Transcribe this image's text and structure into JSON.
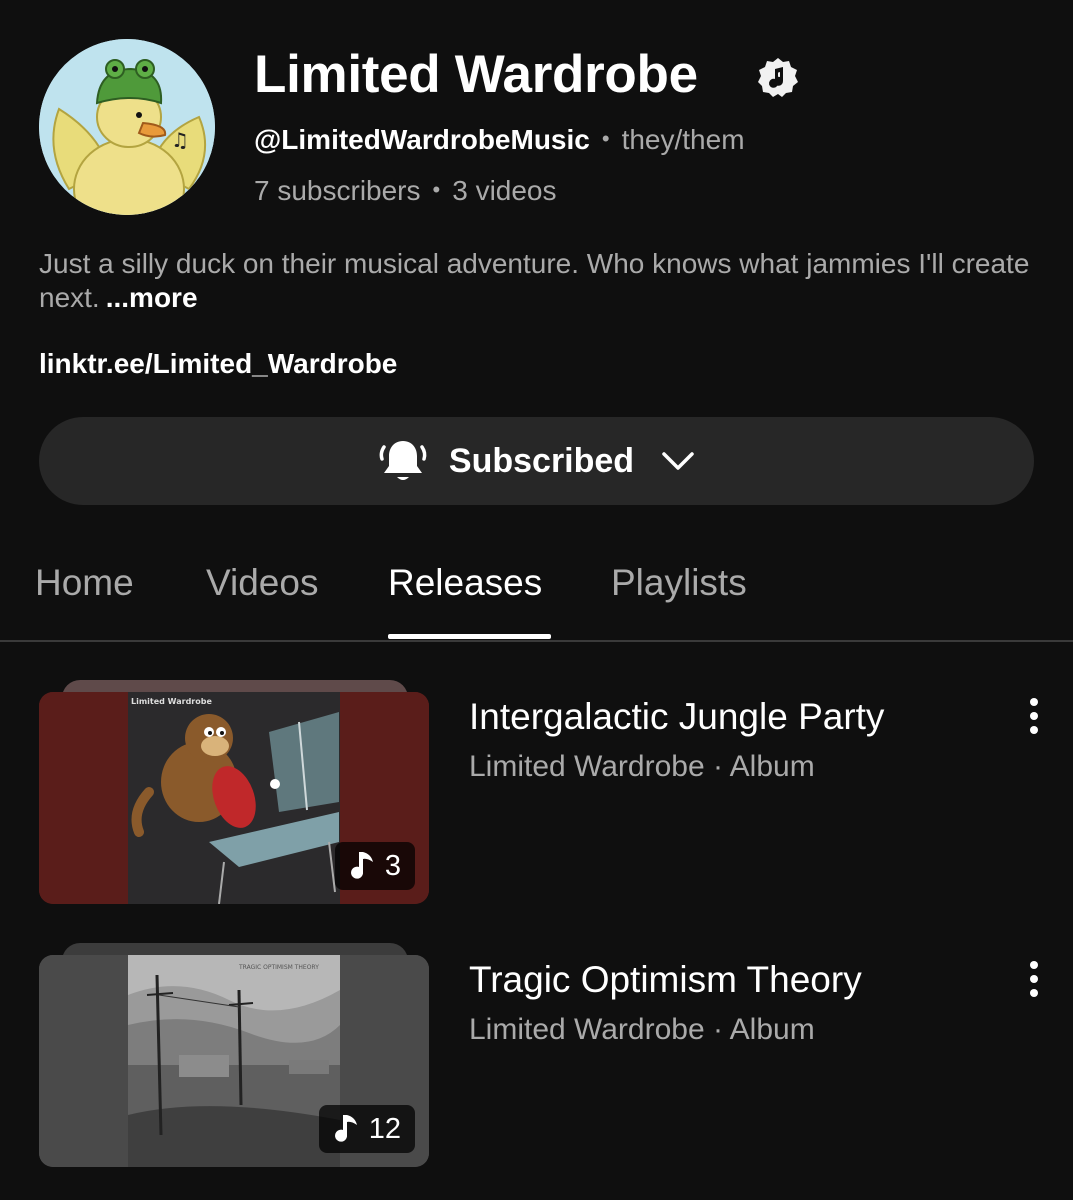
{
  "channel": {
    "name": "Limited Wardrobe",
    "handle": "@LimitedWardrobeMusic",
    "pronouns": "they/them",
    "subscribers": "7 subscribers",
    "videos": "3 videos",
    "description": "Just a silly duck on their musical adventure. Who knows what jammies I'll create next.",
    "more_label": "...more",
    "link": "linktr.ee/Limited_Wardrobe",
    "verified_icon": "music-note-badge-icon"
  },
  "subscribe": {
    "label": "Subscribed",
    "icon": "bell-icon"
  },
  "separator": "•",
  "tabs": [
    {
      "label": "Home",
      "active": false
    },
    {
      "label": "Videos",
      "active": false
    },
    {
      "label": "Releases",
      "active": true
    },
    {
      "label": "Playlists",
      "active": false
    }
  ],
  "releases": [
    {
      "title": "Intergalactic Jungle Party",
      "meta": "Limited Wardrobe · Album",
      "track_count": "3",
      "cover_text": "Limited Wardrobe",
      "accent": "#5a1d1a"
    },
    {
      "title": "Tragic Optimism Theory",
      "meta": "Limited Wardrobe · Album",
      "track_count": "12",
      "cover_text": "TRAGIC OPTIMISM THEORY",
      "accent": "#4a4a4a"
    }
  ],
  "colors": {
    "background": "#0f0f0f",
    "button": "#272727",
    "secondary_text": "#aaaaaa",
    "primary_text": "#ffffff"
  }
}
